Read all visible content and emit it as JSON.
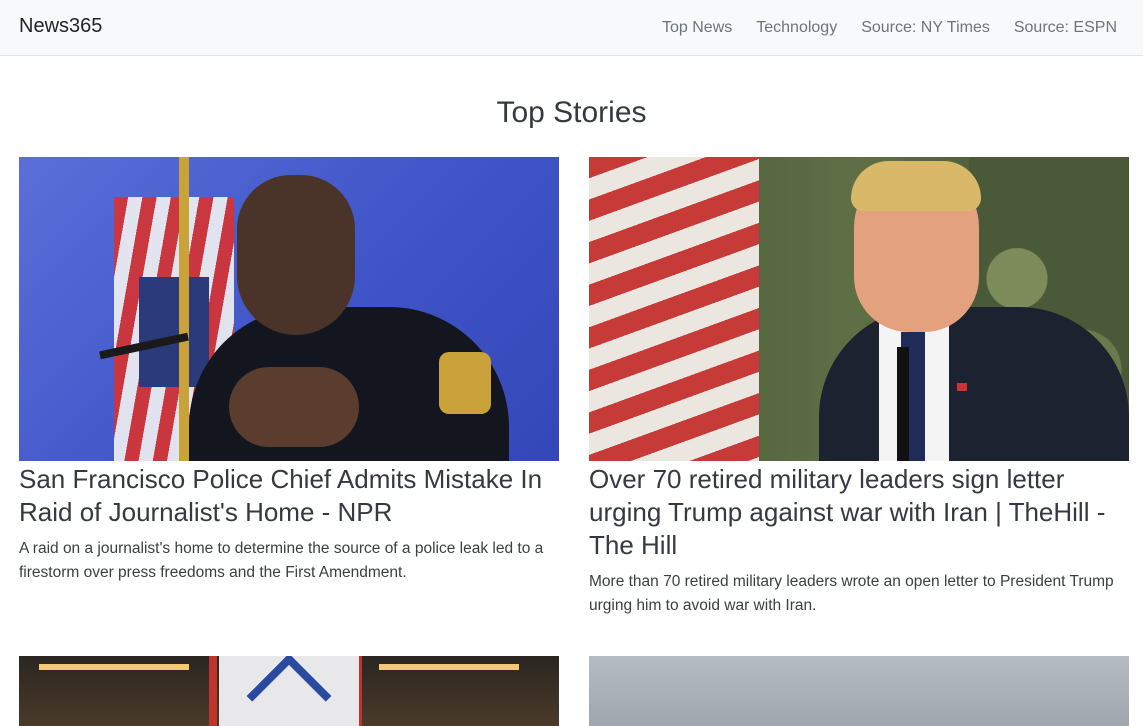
{
  "navbar": {
    "brand": "News365",
    "links": [
      "Top News",
      "Technology",
      "Source: NY Times",
      "Source: ESPN"
    ]
  },
  "main": {
    "heading": "Top Stories",
    "articles": [
      {
        "title": "San Francisco Police Chief Admits Mistake In Raid of Journalist's Home - NPR",
        "description": "A raid on a journalist's home to determine the source of a police leak led to a firestorm over press freedoms and the First Amendment."
      },
      {
        "title": "Over 70 retired military leaders sign letter urging Trump against war with Iran | TheHill - The Hill",
        "description": "More than 70 retired military leaders wrote an open letter to President Trump urging him to avoid war with Iran."
      }
    ]
  }
}
